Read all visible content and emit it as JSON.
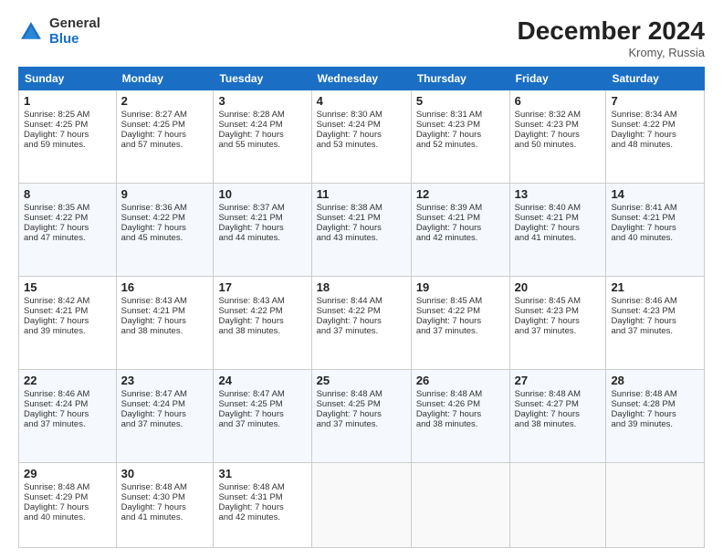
{
  "header": {
    "logo_general": "General",
    "logo_blue": "Blue",
    "month_title": "December 2024",
    "location": "Kromy, Russia"
  },
  "weekdays": [
    "Sunday",
    "Monday",
    "Tuesday",
    "Wednesday",
    "Thursday",
    "Friday",
    "Saturday"
  ],
  "weeks": [
    [
      {
        "day": 1,
        "lines": [
          "Sunrise: 8:25 AM",
          "Sunset: 4:25 PM",
          "Daylight: 7 hours",
          "and 59 minutes."
        ]
      },
      {
        "day": 2,
        "lines": [
          "Sunrise: 8:27 AM",
          "Sunset: 4:25 PM",
          "Daylight: 7 hours",
          "and 57 minutes."
        ]
      },
      {
        "day": 3,
        "lines": [
          "Sunrise: 8:28 AM",
          "Sunset: 4:24 PM",
          "Daylight: 7 hours",
          "and 55 minutes."
        ]
      },
      {
        "day": 4,
        "lines": [
          "Sunrise: 8:30 AM",
          "Sunset: 4:24 PM",
          "Daylight: 7 hours",
          "and 53 minutes."
        ]
      },
      {
        "day": 5,
        "lines": [
          "Sunrise: 8:31 AM",
          "Sunset: 4:23 PM",
          "Daylight: 7 hours",
          "and 52 minutes."
        ]
      },
      {
        "day": 6,
        "lines": [
          "Sunrise: 8:32 AM",
          "Sunset: 4:23 PM",
          "Daylight: 7 hours",
          "and 50 minutes."
        ]
      },
      {
        "day": 7,
        "lines": [
          "Sunrise: 8:34 AM",
          "Sunset: 4:22 PM",
          "Daylight: 7 hours",
          "and 48 minutes."
        ]
      }
    ],
    [
      {
        "day": 8,
        "lines": [
          "Sunrise: 8:35 AM",
          "Sunset: 4:22 PM",
          "Daylight: 7 hours",
          "and 47 minutes."
        ]
      },
      {
        "day": 9,
        "lines": [
          "Sunrise: 8:36 AM",
          "Sunset: 4:22 PM",
          "Daylight: 7 hours",
          "and 45 minutes."
        ]
      },
      {
        "day": 10,
        "lines": [
          "Sunrise: 8:37 AM",
          "Sunset: 4:21 PM",
          "Daylight: 7 hours",
          "and 44 minutes."
        ]
      },
      {
        "day": 11,
        "lines": [
          "Sunrise: 8:38 AM",
          "Sunset: 4:21 PM",
          "Daylight: 7 hours",
          "and 43 minutes."
        ]
      },
      {
        "day": 12,
        "lines": [
          "Sunrise: 8:39 AM",
          "Sunset: 4:21 PM",
          "Daylight: 7 hours",
          "and 42 minutes."
        ]
      },
      {
        "day": 13,
        "lines": [
          "Sunrise: 8:40 AM",
          "Sunset: 4:21 PM",
          "Daylight: 7 hours",
          "and 41 minutes."
        ]
      },
      {
        "day": 14,
        "lines": [
          "Sunrise: 8:41 AM",
          "Sunset: 4:21 PM",
          "Daylight: 7 hours",
          "and 40 minutes."
        ]
      }
    ],
    [
      {
        "day": 15,
        "lines": [
          "Sunrise: 8:42 AM",
          "Sunset: 4:21 PM",
          "Daylight: 7 hours",
          "and 39 minutes."
        ]
      },
      {
        "day": 16,
        "lines": [
          "Sunrise: 8:43 AM",
          "Sunset: 4:21 PM",
          "Daylight: 7 hours",
          "and 38 minutes."
        ]
      },
      {
        "day": 17,
        "lines": [
          "Sunrise: 8:43 AM",
          "Sunset: 4:22 PM",
          "Daylight: 7 hours",
          "and 38 minutes."
        ]
      },
      {
        "day": 18,
        "lines": [
          "Sunrise: 8:44 AM",
          "Sunset: 4:22 PM",
          "Daylight: 7 hours",
          "and 37 minutes."
        ]
      },
      {
        "day": 19,
        "lines": [
          "Sunrise: 8:45 AM",
          "Sunset: 4:22 PM",
          "Daylight: 7 hours",
          "and 37 minutes."
        ]
      },
      {
        "day": 20,
        "lines": [
          "Sunrise: 8:45 AM",
          "Sunset: 4:23 PM",
          "Daylight: 7 hours",
          "and 37 minutes."
        ]
      },
      {
        "day": 21,
        "lines": [
          "Sunrise: 8:46 AM",
          "Sunset: 4:23 PM",
          "Daylight: 7 hours",
          "and 37 minutes."
        ]
      }
    ],
    [
      {
        "day": 22,
        "lines": [
          "Sunrise: 8:46 AM",
          "Sunset: 4:24 PM",
          "Daylight: 7 hours",
          "and 37 minutes."
        ]
      },
      {
        "day": 23,
        "lines": [
          "Sunrise: 8:47 AM",
          "Sunset: 4:24 PM",
          "Daylight: 7 hours",
          "and 37 minutes."
        ]
      },
      {
        "day": 24,
        "lines": [
          "Sunrise: 8:47 AM",
          "Sunset: 4:25 PM",
          "Daylight: 7 hours",
          "and 37 minutes."
        ]
      },
      {
        "day": 25,
        "lines": [
          "Sunrise: 8:48 AM",
          "Sunset: 4:25 PM",
          "Daylight: 7 hours",
          "and 37 minutes."
        ]
      },
      {
        "day": 26,
        "lines": [
          "Sunrise: 8:48 AM",
          "Sunset: 4:26 PM",
          "Daylight: 7 hours",
          "and 38 minutes."
        ]
      },
      {
        "day": 27,
        "lines": [
          "Sunrise: 8:48 AM",
          "Sunset: 4:27 PM",
          "Daylight: 7 hours",
          "and 38 minutes."
        ]
      },
      {
        "day": 28,
        "lines": [
          "Sunrise: 8:48 AM",
          "Sunset: 4:28 PM",
          "Daylight: 7 hours",
          "and 39 minutes."
        ]
      }
    ],
    [
      {
        "day": 29,
        "lines": [
          "Sunrise: 8:48 AM",
          "Sunset: 4:29 PM",
          "Daylight: 7 hours",
          "and 40 minutes."
        ]
      },
      {
        "day": 30,
        "lines": [
          "Sunrise: 8:48 AM",
          "Sunset: 4:30 PM",
          "Daylight: 7 hours",
          "and 41 minutes."
        ]
      },
      {
        "day": 31,
        "lines": [
          "Sunrise: 8:48 AM",
          "Sunset: 4:31 PM",
          "Daylight: 7 hours",
          "and 42 minutes."
        ]
      },
      null,
      null,
      null,
      null
    ]
  ]
}
